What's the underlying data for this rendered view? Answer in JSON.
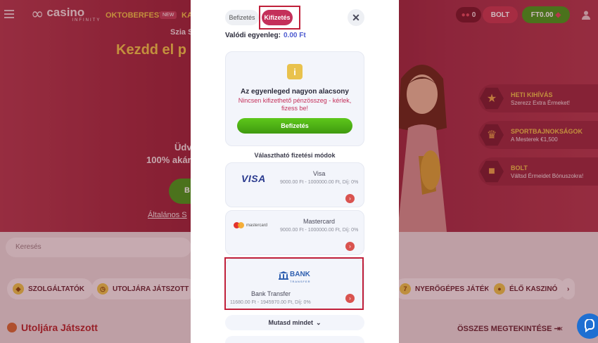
{
  "header": {
    "logo_text": "casino",
    "logo_sub": "INFINITY",
    "nav_oktoberfest": "OKTOBERFEST",
    "nav_new_badge": "NEW",
    "nav_ka": "KA",
    "ticket_count": "0",
    "shop_button": "BOLT",
    "balance_button": "FT0.00"
  },
  "hero": {
    "greeting": "Szia S",
    "title": "Kezdd el p",
    "welcome": "Üdv",
    "bonus": "100% akár",
    "cta_label": "B",
    "terms_link": "Általános S"
  },
  "promos": [
    {
      "title": "HETI KIHÍVÁS",
      "subtitle": "Szerezz Extra Érmeket!",
      "icon": "star-icon"
    },
    {
      "title": "SPORTBAJNOKSÁGOK",
      "subtitle": "A Mesterek €1,500",
      "icon": "trophy-icon"
    },
    {
      "title": "BOLT",
      "subtitle": "Váltsd Érmeidet Bónuszokra!",
      "icon": "gift-icon"
    }
  ],
  "search": {
    "placeholder": "Keresés"
  },
  "categories": [
    "SZOLGÁLTATÓK",
    "UTOLJÁRA JÁTSZOTT",
    "NYERŐGÉPES JÁTÉKOK",
    "ÉLŐ KASZINÓ"
  ],
  "recent": {
    "title": "Utoljára Játszott",
    "see_all": "ÖSSZES MEGTEKINTÉSE"
  },
  "modal": {
    "tab_deposit": "Befizetés",
    "tab_withdraw": "Kifizetés",
    "balance_label": "Valódi egyenleg:",
    "balance_value": "0.00 Ft",
    "info_title": "Az egyenleged nagyon alacsony",
    "info_text": "Nincsen kifizethető pénzösszeg - kérlek, fizess be!",
    "info_button": "Befizetés",
    "methods_title": "Választható fizetési módok",
    "methods": [
      {
        "name": "Visa",
        "logo_text": "VISA",
        "range": "9000.00 Ft - 1000000.00 Ft, Díj: 0%"
      },
      {
        "name": "Mastercard",
        "logo_text": "mastercard",
        "range": "9000.00 Ft - 1000000.00 Ft, Díj: 0%"
      },
      {
        "name": "Bank Transfer",
        "logo_text": "BANK",
        "logo_sub": "TRANSFER",
        "range": "11680.00 Ft - 1945970.00 Ft, Díj: 0%"
      }
    ],
    "show_all": "Mutasd mindet"
  },
  "colors": {
    "brand_red": "#c4305a",
    "deposit_green": "#4a9a1e",
    "balance_blue": "#4d5bd0",
    "highlight": "#c01f3a"
  }
}
